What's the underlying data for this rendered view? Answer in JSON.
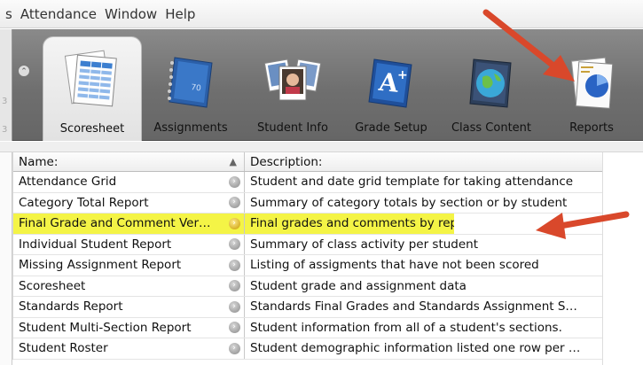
{
  "menu": {
    "items": [
      "s",
      "Attendance",
      "Window",
      "Help"
    ]
  },
  "left_strip": {
    "n1": "3",
    "n2": "3"
  },
  "toolbar": {
    "tabs": [
      {
        "label": "Scoresheet",
        "icon": "scoresheet-icon"
      },
      {
        "label": "Assignments",
        "icon": "notebook-icon"
      },
      {
        "label": "Student Info",
        "icon": "student-photos-icon"
      },
      {
        "label": "Grade Setup",
        "icon": "grade-setup-icon"
      },
      {
        "label": "Class Content",
        "icon": "globe-book-icon"
      },
      {
        "label": "Reports",
        "icon": "reports-pie-icon"
      }
    ]
  },
  "table": {
    "headers": {
      "name": "Name:",
      "description": "Description:",
      "sort_glyph": "▲"
    },
    "rows": [
      {
        "name": "Attendance Grid",
        "description": "Student and date grid template for taking attendance"
      },
      {
        "name": "Category Total Report",
        "description": "Summary of category totals by section or by student"
      },
      {
        "name": "Final Grade and Comment Ver…",
        "description": "Final grades and comments by reporting term"
      },
      {
        "name": "Individual Student Report",
        "description": "Summary of class activity per student"
      },
      {
        "name": "Missing Assignment Report",
        "description": "Listing of assigments that have not been scored"
      },
      {
        "name": "Scoresheet",
        "description": "Student grade and assignment data"
      },
      {
        "name": "Standards Report",
        "description": "Standards Final Grades and Standards Assignment S…"
      },
      {
        "name": "Student Multi-Section Report",
        "description": "Student information from all of a student's sections."
      },
      {
        "name": "Student Roster",
        "description": "Student demographic information listed one row per …"
      }
    ]
  },
  "colors": {
    "highlight": "#f4f446",
    "arrow": "#d9482b",
    "toolbar": "#7a7a7a"
  }
}
